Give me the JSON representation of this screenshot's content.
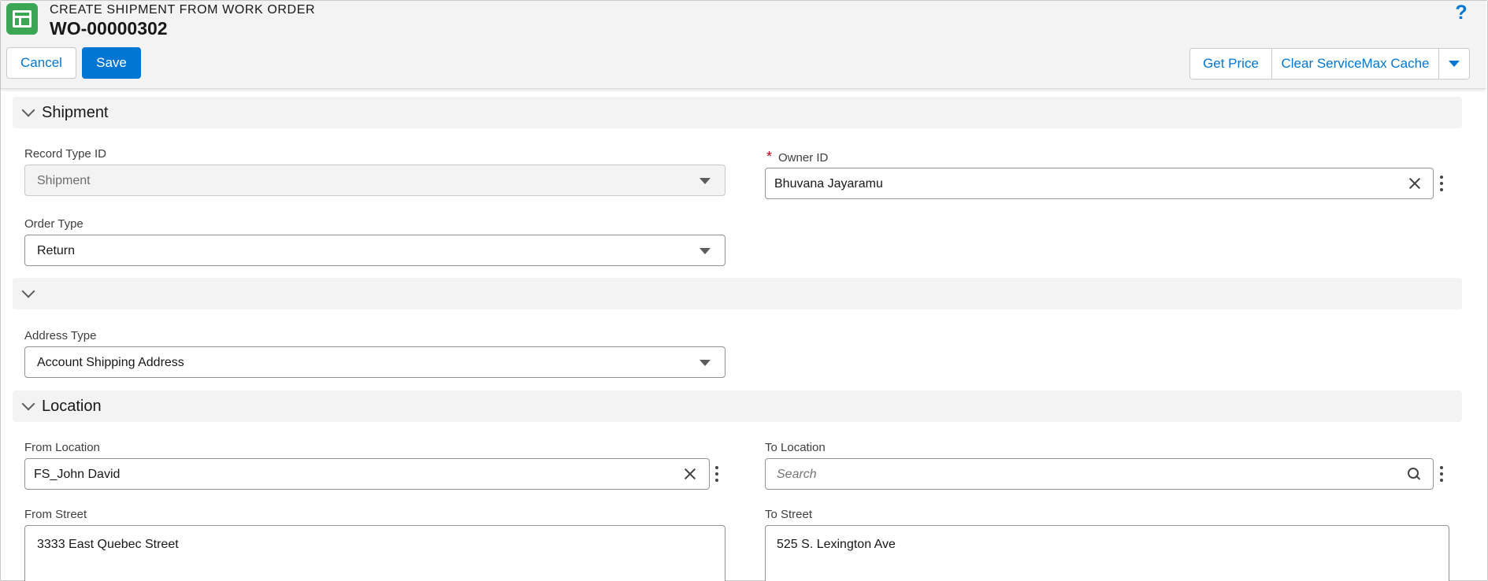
{
  "header": {
    "eyebrow": "CREATE SHIPMENT FROM WORK ORDER",
    "record_name": "WO-00000302",
    "help_label": "?",
    "cancel_label": "Cancel",
    "save_label": "Save",
    "get_price_label": "Get Price",
    "clear_cache_label": "Clear ServiceMax Cache"
  },
  "sections": {
    "shipment": {
      "title": "Shipment"
    },
    "address": {
      "title": ""
    },
    "location": {
      "title": "Location"
    }
  },
  "fields": {
    "record_type": {
      "label": "Record Type ID",
      "value": "Shipment"
    },
    "owner": {
      "label": "Owner ID",
      "required_mark": "*",
      "value": "Bhuvana Jayaramu"
    },
    "order_type": {
      "label": "Order Type",
      "value": "Return"
    },
    "address_type": {
      "label": "Address Type",
      "value": "Account Shipping Address"
    },
    "from_location": {
      "label": "From Location",
      "value": "FS_John David"
    },
    "to_location": {
      "label": "To Location",
      "placeholder": "Search"
    },
    "from_street": {
      "label": "From Street",
      "value": "3333 East Quebec Street"
    },
    "to_street": {
      "label": "To Street",
      "value": "525 S. Lexington Ave"
    }
  },
  "colors": {
    "brand_blue": "#0176d3",
    "app_icon_green": "#3ba755",
    "required_red": "#ba0517"
  },
  "icons": [
    "table-icon",
    "help-icon",
    "chevron-down-icon",
    "caret-down-icon",
    "close-icon",
    "search-icon",
    "more-actions-icon"
  ]
}
